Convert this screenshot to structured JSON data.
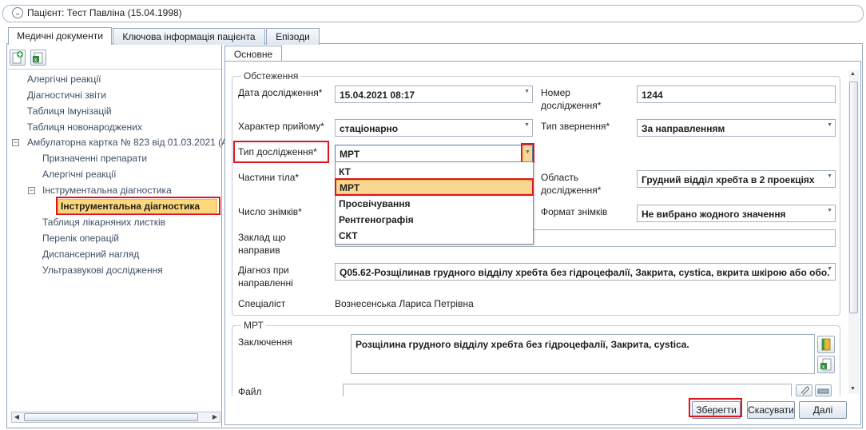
{
  "patient": {
    "title": "Пацієнт: Тест Павліна (15.04.1998)"
  },
  "tabs": [
    {
      "label": "Медичні документи",
      "active": true
    },
    {
      "label": "Ключова інформація пацієнта",
      "active": false
    },
    {
      "label": "Епізоди",
      "active": false
    }
  ],
  "tree": {
    "items": [
      "Алергічні реакції",
      "Діагностичні звіти",
      "Таблиця Імунізацій",
      "Таблиця новонароджених",
      "Амбулаторна картка № 823 від 01.03.2021 (А",
      "Призначенні препарати",
      "Алергічні реакції",
      "Інструментальна діагностика",
      "Інструментальна діагностика",
      "Таблиця лікарняних листків",
      "Перелік операцій",
      "Диспансерний нагляд",
      "Ультразвукові дослідження"
    ],
    "toggle_collapsed": "⊟"
  },
  "inner_tab": {
    "label": "Основне"
  },
  "exam": {
    "group_title": "Обстеження",
    "date_label": "Дата дослідження*",
    "date_value": "15.04.2021 08:17",
    "number_label": "Номер дослідження*",
    "number_value": "1244",
    "reception_label": "Характер прийому*",
    "reception_value": "стаціонарно",
    "referral_type_label": "Тип звернення*",
    "referral_type_value": "За направленням",
    "study_type_label": "Тип дослідження*",
    "study_type_value": "МРТ",
    "body_parts_label": "Частини тіла*",
    "area_label": "Область дослідження*",
    "area_value": "Грудний відділ хребта в 2 проекціях",
    "images_count_label": "Число знімків*",
    "images_format_label": "Формат знімків",
    "images_format_value": "Не вибрано жодного значення",
    "institution_label": "Заклад що направив",
    "institution_value": "",
    "diagnosis_label": "Діагноз при направленні",
    "diagnosis_value": "Q05.62-Розщілинав грудного відділу хребта без гідроцефалії, Закрита, cystica, вкрита шкірою або обо.",
    "specialist_label": "Спеціаліст",
    "specialist_value": "Вознесенська Лариса Петрівна"
  },
  "dropdown": {
    "options": [
      "КТ",
      "МРТ",
      "Просвічування",
      "Рентгенографія",
      "СКТ"
    ],
    "selected": "МРТ"
  },
  "mri": {
    "group_title": "МРТ",
    "conclusion_label": "Заключення",
    "conclusion_value": "Розщілина грудного відділу хребта без гідроцефалії, Закрита, cystica.",
    "file_label": "Файл",
    "file_value": ""
  },
  "buttons": {
    "save": "Зберегти",
    "cancel": "Скасувати",
    "next": "Далі"
  }
}
